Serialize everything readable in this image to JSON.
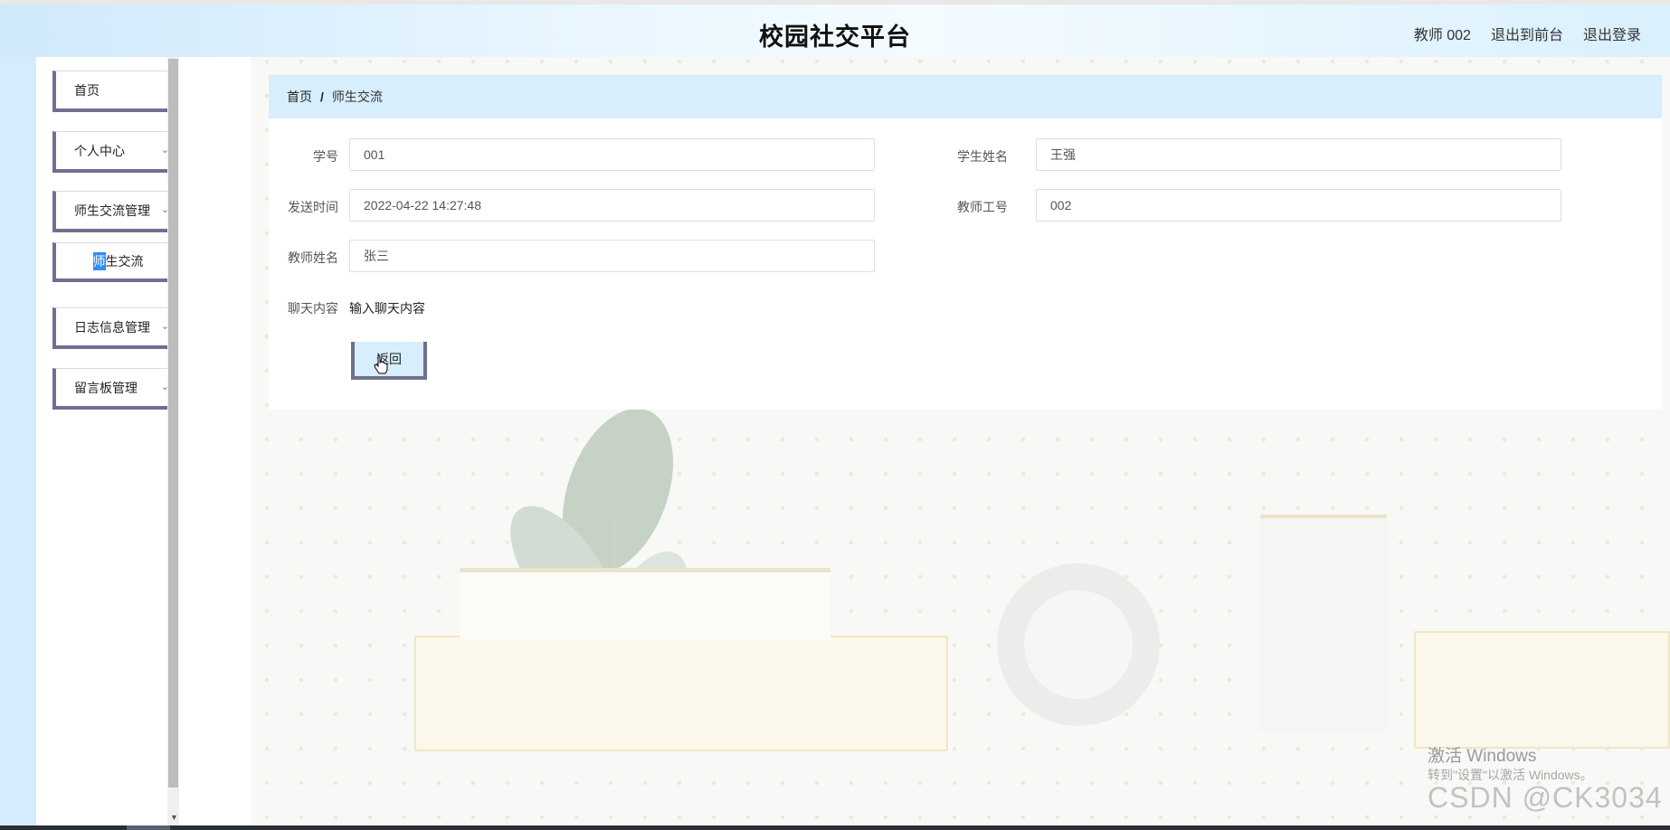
{
  "header": {
    "title": "校园社交平台",
    "user": "教师 002",
    "exit_frontend": "退出到前台",
    "logout": "退出登录"
  },
  "sidebar": {
    "items": [
      {
        "label": "首页"
      },
      {
        "label": "个人中心"
      },
      {
        "label": "师生交流管理"
      },
      {
        "label_first_char": "师",
        "label_rest": "生交流"
      },
      {
        "label": "日志信息管理"
      },
      {
        "label": "留言板管理"
      }
    ]
  },
  "breadcrumb": {
    "home": "首页",
    "separator": "/",
    "current": "师生交流"
  },
  "form": {
    "student_id_label": "学号",
    "student_id_value": "001",
    "student_name_label": "学生姓名",
    "student_name_value": "王强",
    "send_time_label": "发送时间",
    "send_time_value": "2022-04-22 14:27:48",
    "teacher_id_label": "教师工号",
    "teacher_id_value": "002",
    "teacher_name_label": "教师姓名",
    "teacher_name_value": "张三",
    "chat_label": "聊天内容",
    "chat_value": "输入聊天内容",
    "back_button": "返回"
  },
  "watermark": {
    "line1": "激活 Windows",
    "line2": "转到\"设置\"以激活 Windows。",
    "csdn": "CSDN @CK3034"
  },
  "colors": {
    "header_bg": "#e9f6ff",
    "rail": "#d4ecfb",
    "breadcrumb_bg": "#d7eefc",
    "menu_border": "#6f6f8f",
    "highlight": "#2f8ef5"
  }
}
